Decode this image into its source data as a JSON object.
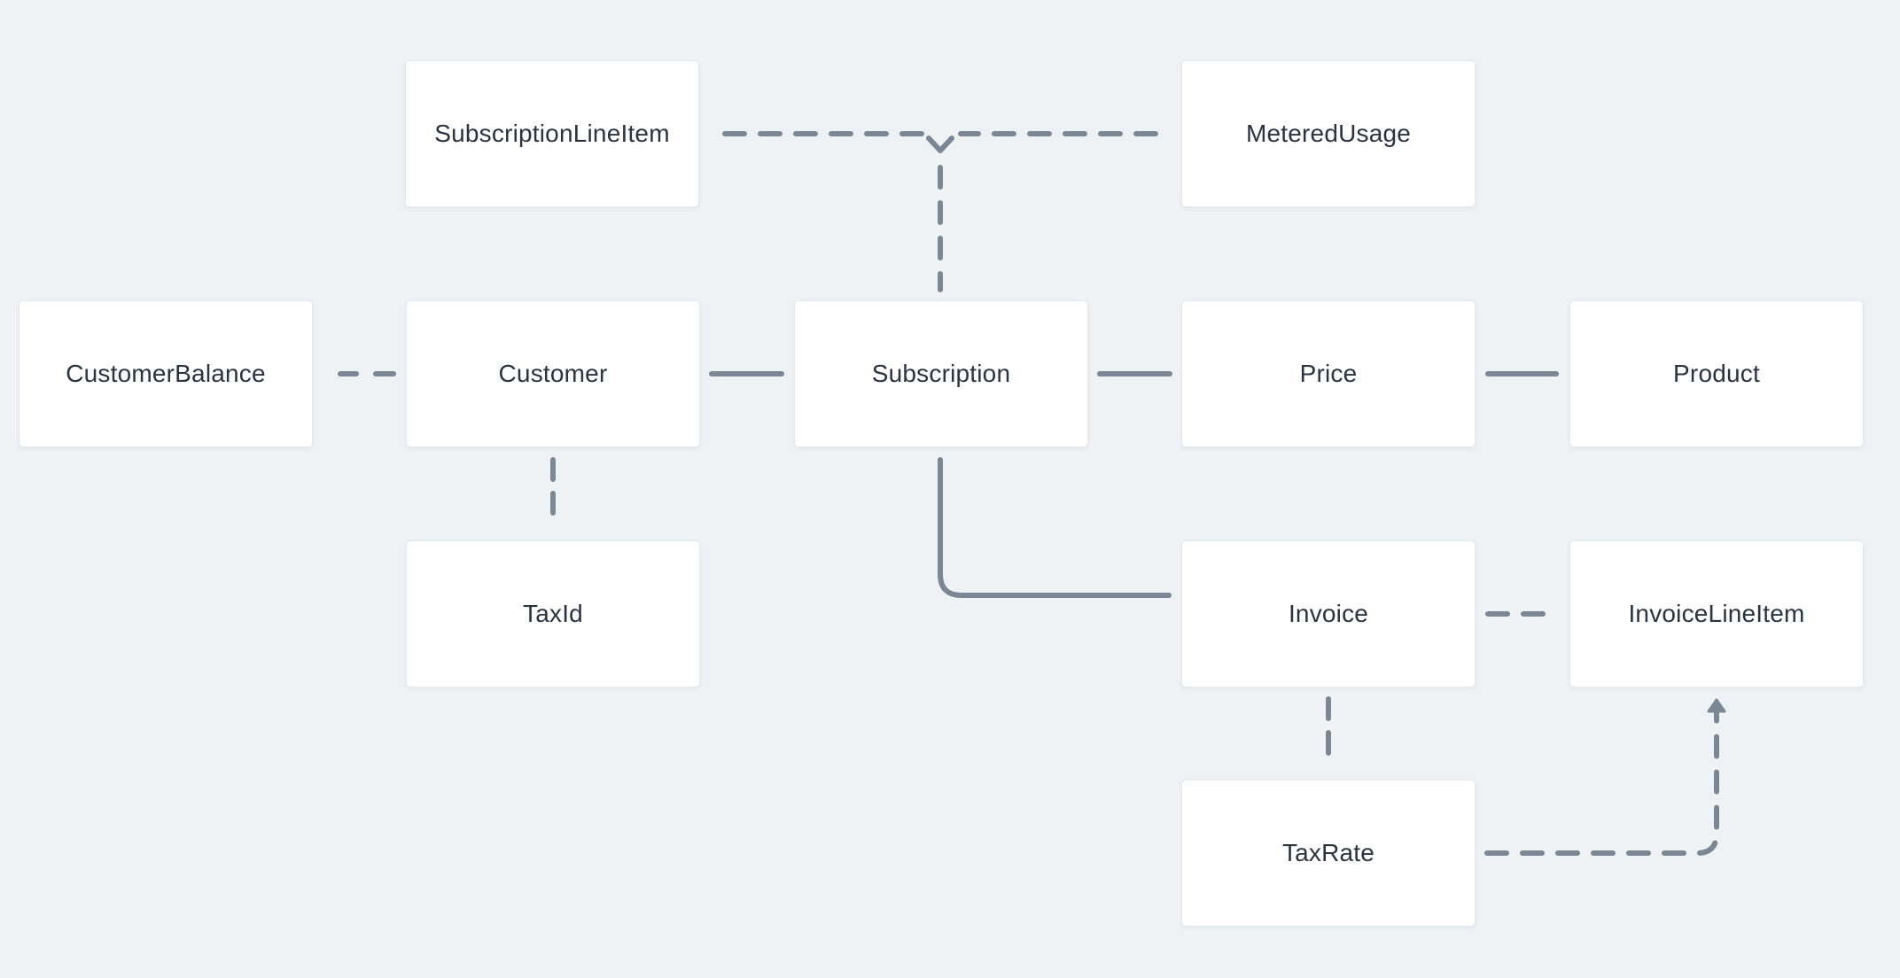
{
  "diagram": {
    "nodes": [
      {
        "id": "subscription_line_item",
        "label": "SubscriptionLineItem",
        "col": 1,
        "row": 0
      },
      {
        "id": "metered_usage",
        "label": "MeteredUsage",
        "col": 3,
        "row": 0
      },
      {
        "id": "customer_balance",
        "label": "CustomerBalance",
        "col": 0,
        "row": 1
      },
      {
        "id": "customer",
        "label": "Customer",
        "col": 1,
        "row": 1
      },
      {
        "id": "subscription",
        "label": "Subscription",
        "col": 2,
        "row": 1
      },
      {
        "id": "price",
        "label": "Price",
        "col": 3,
        "row": 1
      },
      {
        "id": "product",
        "label": "Product",
        "col": 4,
        "row": 1
      },
      {
        "id": "tax_id",
        "label": "TaxId",
        "col": 1,
        "row": 2
      },
      {
        "id": "invoice",
        "label": "Invoice",
        "col": 3,
        "row": 2
      },
      {
        "id": "invoice_line_item",
        "label": "InvoiceLineItem",
        "col": 4,
        "row": 2
      },
      {
        "id": "tax_rate",
        "label": "TaxRate",
        "col": 3,
        "row": 3
      }
    ],
    "edges": [
      {
        "from": "subscription_line_item",
        "to": "subscription",
        "style": "dashed",
        "marker": "merge-fork"
      },
      {
        "from": "metered_usage",
        "to": "subscription",
        "style": "dashed",
        "marker": "merge-fork"
      },
      {
        "from": "customer_balance",
        "to": "customer",
        "style": "dashed",
        "marker": "none"
      },
      {
        "from": "customer",
        "to": "subscription",
        "style": "solid",
        "marker": "none"
      },
      {
        "from": "subscription",
        "to": "price",
        "style": "solid",
        "marker": "none"
      },
      {
        "from": "price",
        "to": "product",
        "style": "solid",
        "marker": "none"
      },
      {
        "from": "customer",
        "to": "tax_id",
        "style": "dashed",
        "marker": "none"
      },
      {
        "from": "subscription",
        "to": "invoice",
        "style": "solid",
        "marker": "none"
      },
      {
        "from": "invoice",
        "to": "invoice_line_item",
        "style": "dashed",
        "marker": "none"
      },
      {
        "from": "invoice",
        "to": "tax_rate",
        "style": "dashed",
        "marker": "none"
      },
      {
        "from": "tax_rate",
        "to": "invoice_line_item",
        "style": "dashed",
        "marker": "arrow"
      }
    ],
    "colors": {
      "background": "#eef2f5",
      "node_fill": "#ffffff",
      "node_border": "#e3e8ee",
      "edge": "#7b8794",
      "label": "#2a3441"
    }
  }
}
